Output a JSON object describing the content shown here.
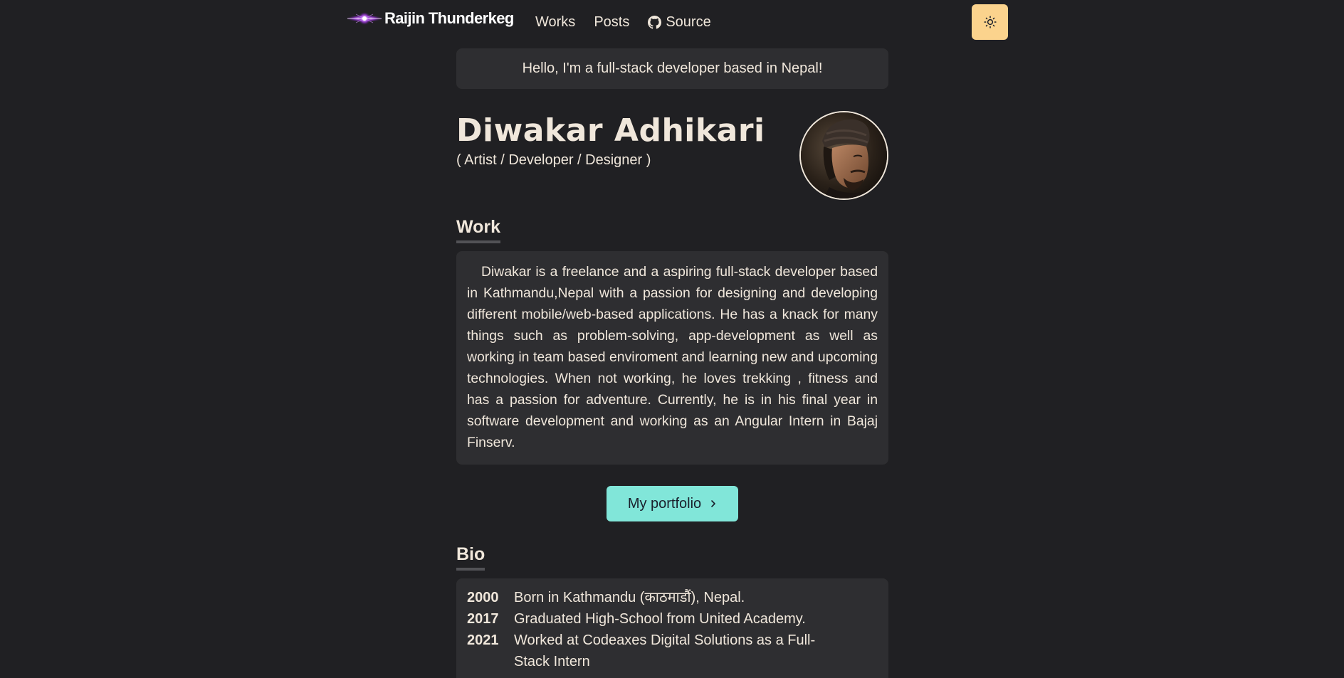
{
  "nav": {
    "logo_text": "Raijin Thunderkeg",
    "links": [
      {
        "label": "Works"
      },
      {
        "label": "Posts"
      },
      {
        "label": "Source",
        "icon": "github-icon"
      }
    ],
    "theme_toggle_icon": "sun-icon"
  },
  "colors": {
    "background": "#202023",
    "card": "#2e2e31",
    "text": "#f0e7db",
    "toggle_bg": "#fbd38d",
    "accent_button": "#81e6d9"
  },
  "greeting": "Hello, I'm a full-stack developer based in Nepal!",
  "profile": {
    "name": "Diwakar Adhikari",
    "roles": "( Artist / Developer / Designer )"
  },
  "work": {
    "title": "Work",
    "paragraph": "Diwakar is a freelance and a aspiring full-stack developer based in Kathmandu,Nepal with a passion for designing and developing different mobile/web-based applications. He has a knack for many things such as problem-solving, app-development as well as working in team based enviroment and learning new and upcoming technologies. When not working, he loves trekking , fitness and has a passion for adventure. Currently, he is in his final year in software development and working as an Angular Intern in Bajaj Finserv.",
    "button_label": "My portfolio"
  },
  "bio": {
    "title": "Bio",
    "entries": [
      {
        "year": "2000",
        "text": "Born in Kathmandu (काठमाडौं), Nepal."
      },
      {
        "year": "2017",
        "text": "Graduated High-School from United Academy."
      },
      {
        "year": "2021",
        "text": "Worked at Codeaxes Digital Solutions as a Full-Stack Intern"
      }
    ]
  }
}
